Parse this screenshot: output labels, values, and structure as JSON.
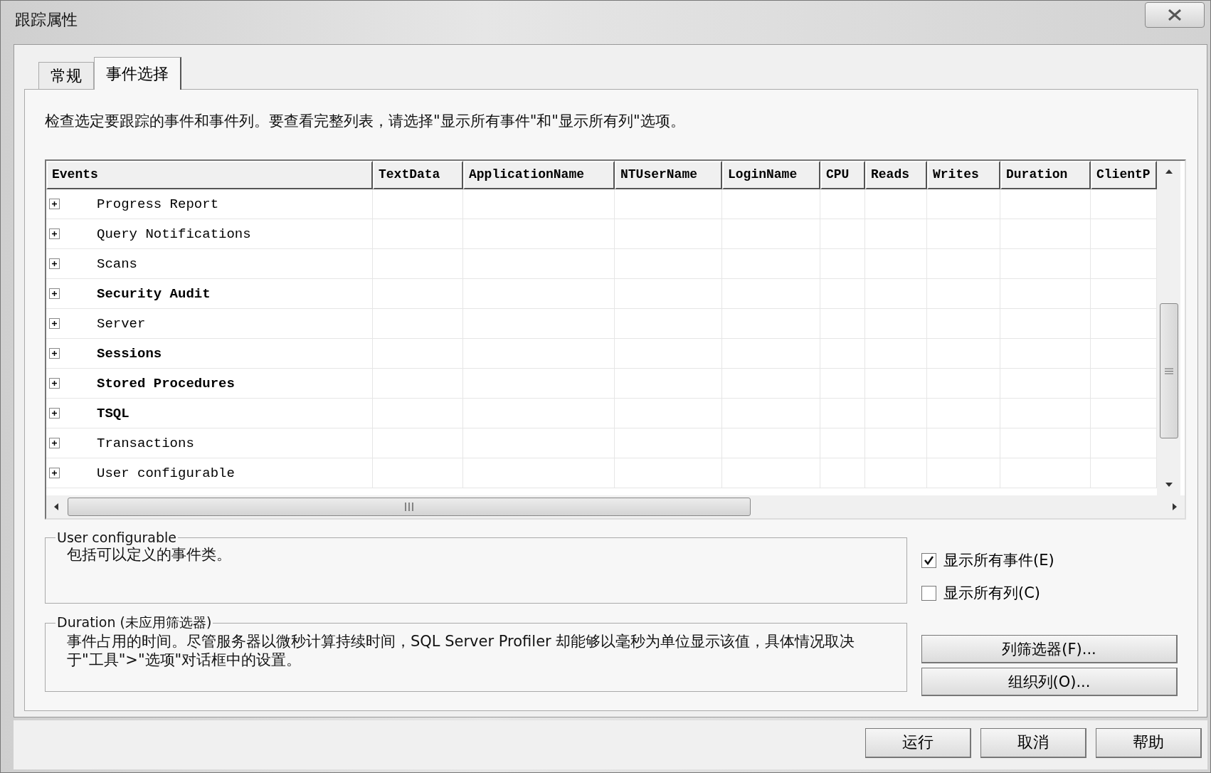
{
  "window": {
    "title": "跟踪属性"
  },
  "tabs": [
    {
      "label": "常规",
      "selected": false
    },
    {
      "label": "事件选择",
      "selected": true
    }
  ],
  "instructions": "检查选定要跟踪的事件和事件列。要查看完整列表，请选择\"显示所有事件\"和\"显示所有列\"选项。",
  "table": {
    "columns": [
      "Events",
      "TextData",
      "ApplicationName",
      "NTUserName",
      "LoginName",
      "CPU",
      "Reads",
      "Writes",
      "Duration",
      "ClientP"
    ],
    "rows": [
      {
        "name": "Progress Report",
        "expanded": false,
        "has_selected_events": false
      },
      {
        "name": "Query Notifications",
        "expanded": false,
        "has_selected_events": false
      },
      {
        "name": "Scans",
        "expanded": false,
        "has_selected_events": false
      },
      {
        "name": "Security Audit",
        "expanded": false,
        "has_selected_events": true
      },
      {
        "name": "Server",
        "expanded": false,
        "has_selected_events": false
      },
      {
        "name": "Sessions",
        "expanded": false,
        "has_selected_events": true
      },
      {
        "name": "Stored Procedures",
        "expanded": false,
        "has_selected_events": true
      },
      {
        "name": "TSQL",
        "expanded": false,
        "has_selected_events": true
      },
      {
        "name": "Transactions",
        "expanded": false,
        "has_selected_events": false
      },
      {
        "name": "User configurable",
        "expanded": false,
        "has_selected_events": false
      }
    ]
  },
  "event_info": {
    "title": "User configurable",
    "description": "包括可以定义的事件类。"
  },
  "column_info": {
    "title": "Duration (未应用筛选器)",
    "description": "事件占用的时间。尽管服务器以微秒计算持续时间，SQL Server Profiler 却能够以毫秒为单位显示该值，具体情况取决于\"工具\">\"选项\"对话框中的设置。"
  },
  "options": [
    {
      "label": "显示所有事件(E)",
      "checked": true
    },
    {
      "label": "显示所有列(C)",
      "checked": false
    }
  ],
  "side_buttons": [
    "列筛选器(F)...",
    "组织列(O)..."
  ],
  "footer_buttons": [
    "运行",
    "取消",
    "帮助"
  ]
}
